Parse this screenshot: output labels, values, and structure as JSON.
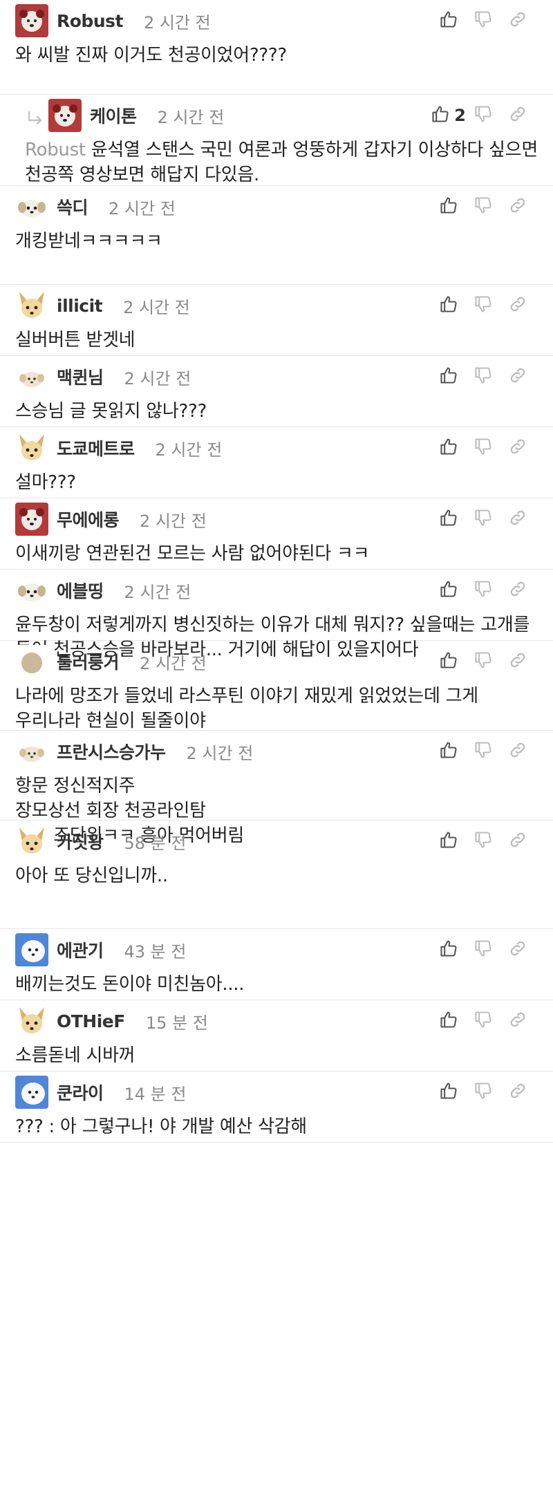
{
  "comments": [
    {
      "avatar": "avatar-red-dog-icon",
      "nickname": "Robust",
      "time": "2 시간 전",
      "body": "와 씨발 진짜 이거도 천공이었어????",
      "likes": "",
      "reply": false
    },
    {
      "avatar": "avatar-red-dog-icon",
      "nickname": "케이톤",
      "time": "2 시간 전",
      "mention": "Robust",
      "body": "윤석열 스탠스 국민 여론과 엉뚱하게 갑자기 이상하다 싶으면 천공쪽 영상보면 해답지 다있음.",
      "likes": "2",
      "reply": true
    },
    {
      "avatar": "avatar-puppy-icon",
      "nickname": "쓱디",
      "time": "2 시간 전",
      "body": "개킹받네ㅋㅋㅋㅋㅋ",
      "likes": "",
      "reply": false
    },
    {
      "avatar": "avatar-fox-dog-icon",
      "nickname": "illicit",
      "time": "2 시간 전",
      "body": "실버버튼 받겟네",
      "likes": "",
      "reply": false
    },
    {
      "avatar": "avatar-small-puppy-icon",
      "nickname": "맥퀸님",
      "time": "2 시간 전",
      "body": "스승님 글 못읽지 않나???",
      "likes": "",
      "reply": false
    },
    {
      "avatar": "avatar-fox-dog-icon",
      "nickname": "도쿄메트로",
      "time": "2 시간 전",
      "body": "설마???",
      "likes": "",
      "reply": false
    },
    {
      "avatar": "avatar-red-dog-icon",
      "nickname": "무에에롱",
      "time": "2 시간 전",
      "body": "이새끼랑 연관된건 모르는 사람 없어야된다 ㅋㅋ",
      "likes": "",
      "reply": false
    },
    {
      "avatar": "avatar-puppy-icon",
      "nickname": "에블띵",
      "time": "2 시간 전",
      "body": "윤두창이 저렇게까지 병신짓하는 이유가 대체 뭐지?? 싶을때는 고개를 들어 천공스승을 바라보라... 거기에 해답이 있을지어다",
      "likes": "",
      "reply": false
    },
    {
      "avatar": "avatar-circle-icon",
      "nickname": "툴러룽거",
      "time": "2 시간 전",
      "body": "나라에 망조가 들었네 라스푸틴 이야기 재밌게 읽었었는데 그게 우리나라 현실이 될줄이야",
      "likes": "",
      "reply": false
    },
    {
      "avatar": "avatar-small-puppy-icon",
      "nickname": "프란시스승가누",
      "time": "2 시간 전",
      "body": "항문 정신적지주\n장모상선 회장 천공라인탐\n회사 조단위ㅋㅋ 흥아 먹어버림",
      "likes": "",
      "reply": false
    },
    {
      "avatar": "avatar-fox-dog-icon",
      "nickname": "카짓왕",
      "time": "58 분 전",
      "body": "아아 또 당신입니까..",
      "likes": "",
      "reply": false
    },
    {
      "avatar": "avatar-white-dog-icon",
      "nickname": "에관기",
      "time": "43 분 전",
      "body": "배끼는것도 돈이야 미친놈아....",
      "likes": "",
      "reply": false
    },
    {
      "avatar": "avatar-fox-dog-icon",
      "nickname": "OTHieF",
      "time": "15 분 전",
      "body": "소름돋네 시바꺼",
      "likes": "",
      "reply": false
    },
    {
      "avatar": "avatar-white-dog-icon",
      "nickname": "쿤라이",
      "time": "14 분 전",
      "body": "??? : 아 그렇구나! 야 개발 예산 삭감해",
      "likes": "",
      "reply": false
    }
  ],
  "colors": {
    "divider": "#e6e6e6",
    "time": "#8a8a8a",
    "mention": "#9a9a9a",
    "icon": "#555555",
    "icon_faded": "#bdbdbd"
  }
}
